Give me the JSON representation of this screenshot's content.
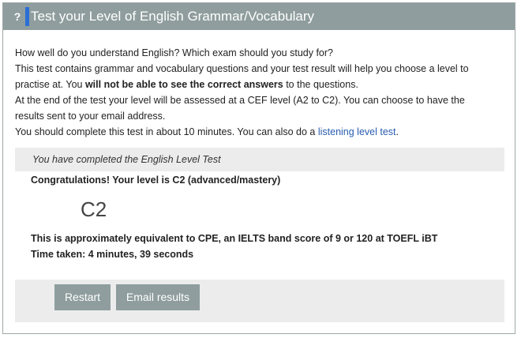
{
  "header": {
    "icon": "question-mark-icon",
    "icon_glyph": "?",
    "title": "Test your Level of English Grammar/Vocabulary",
    "background": "#8f9d9e",
    "accent": "#2b6fd6"
  },
  "intro": {
    "line1": "How well do you understand English? Which exam should you study for?",
    "line2": "This test contains grammar and vocabulary questions and your test result will help you choose a level to",
    "line3_pre": "practise at. You ",
    "line3_bold": "will not be able to see the correct answers",
    "line3_post": " to the questions.",
    "line4": "At the end of the test your level will be assessed at a CEF level (A2 to C2). You can choose to have the",
    "line5": "results sent to your email address.",
    "line6_pre": "You should complete this test in about 10 minutes. You can also do a ",
    "line6_link": "listening level test",
    "line6_post": "."
  },
  "result": {
    "completed": "You have completed the English Level Test",
    "congrats": "Congratulations! Your level is C2 (advanced/mastery)",
    "level": "C2",
    "equivalent": "This is approximately equivalent to CPE, an IELTS band score of 9 or 120 at TOEFL iBT",
    "time_taken": "Time taken: 4 minutes, 39 seconds"
  },
  "buttons": {
    "restart": "Restart",
    "email": "Email results"
  }
}
